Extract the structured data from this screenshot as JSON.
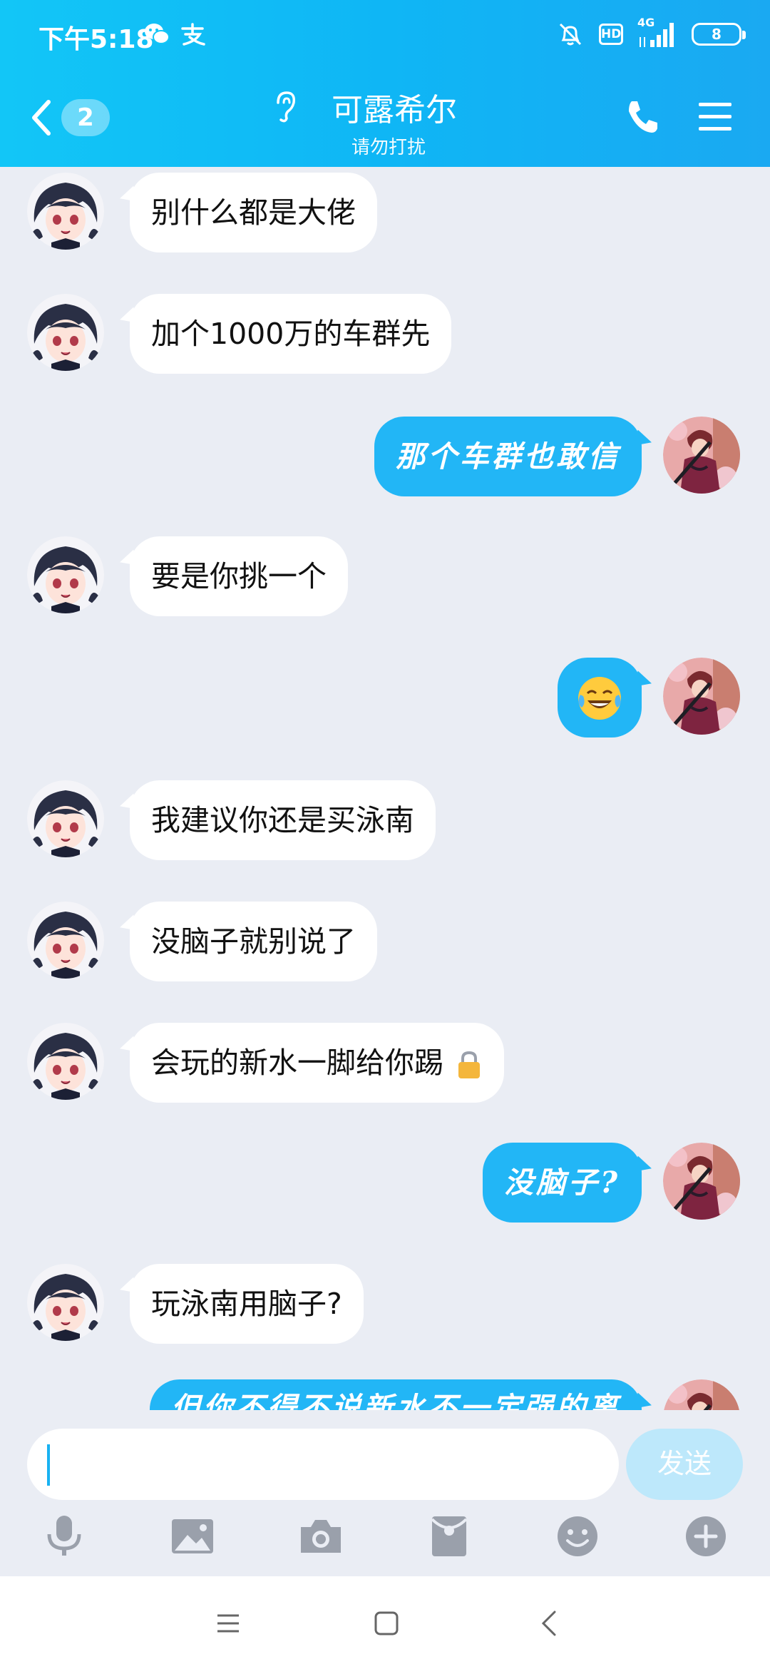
{
  "status_bar": {
    "time": "下午5:18",
    "network": "4G",
    "hd": "HD",
    "battery": "8"
  },
  "header": {
    "unread_count": "2",
    "title": "可露希尔",
    "subtitle": "请勿打扰"
  },
  "messages": [
    {
      "sender": "peer",
      "text": "别什么都是大佬"
    },
    {
      "sender": "peer",
      "text": "加个1000万的车群先"
    },
    {
      "sender": "self",
      "text": "那个车群也敢信"
    },
    {
      "sender": "peer",
      "text": "要是你挑一个"
    },
    {
      "sender": "self",
      "text": "",
      "emoji": "laughing-tears-emoji"
    },
    {
      "sender": "peer",
      "text": "我建议你还是买泳南"
    },
    {
      "sender": "peer",
      "text": "没脑子就别说了"
    },
    {
      "sender": "peer",
      "text": "会玩的新水一脚给你踢",
      "emoji": "lock-emoji"
    },
    {
      "sender": "self",
      "text": "没脑子?"
    },
    {
      "sender": "peer",
      "text": "玩泳南用脑子?"
    },
    {
      "sender": "self",
      "text": "但你不得不说新水不一定强的离"
    }
  ],
  "input": {
    "value": "",
    "placeholder": "",
    "send_label": "发送"
  },
  "toolbar": [
    "microphone-icon",
    "image-icon",
    "camera-icon",
    "red-packet-icon",
    "emoji-icon",
    "plus-icon"
  ],
  "colors": {
    "header": "#12c6f7",
    "self_bubble": "#22b6f6",
    "peer_bubble": "#ffffff",
    "background": "#eaedf4",
    "send_disabled": "#bde8fb",
    "icon_gray": "#9aa0ab"
  }
}
